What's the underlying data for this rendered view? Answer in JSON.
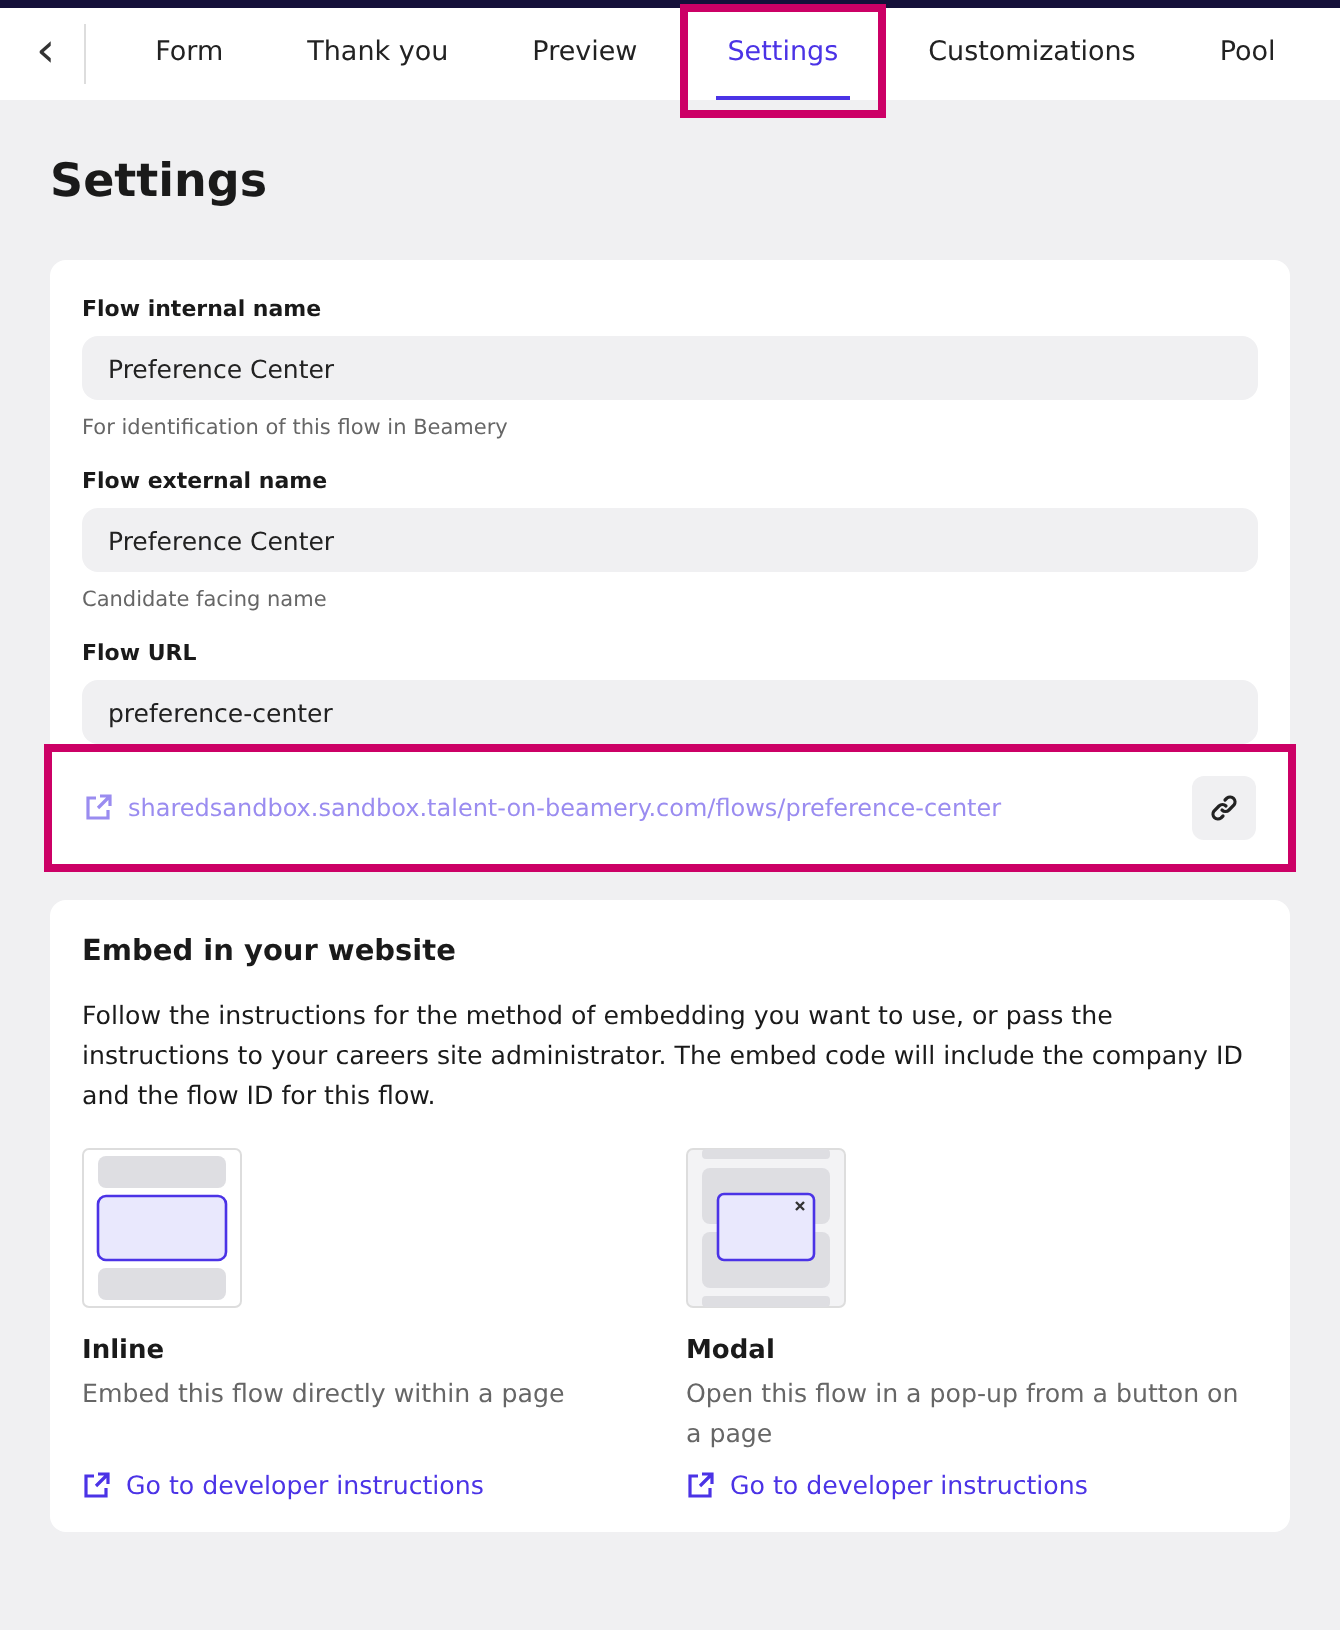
{
  "nav": {
    "back": "‹",
    "tabs": [
      {
        "label": "Form",
        "selected": false,
        "highlighted": false
      },
      {
        "label": "Thank you",
        "selected": false,
        "highlighted": false
      },
      {
        "label": "Preview",
        "selected": false,
        "highlighted": false
      },
      {
        "label": "Settings",
        "selected": true,
        "highlighted": true
      },
      {
        "label": "Customizations",
        "selected": false,
        "highlighted": false
      },
      {
        "label": "Pool",
        "selected": false,
        "highlighted": false
      }
    ]
  },
  "title": "Settings",
  "settings_card": {
    "fields": [
      {
        "label": "Flow internal name",
        "value": "Preference Center",
        "hint": "For identification of this flow in Beamery"
      },
      {
        "label": "Flow external name",
        "value": "Preference Center",
        "hint": "Candidate facing name"
      },
      {
        "label": "Flow URL",
        "value": "preference-center"
      }
    ],
    "url_link": {
      "text": "sharedsandbox.sandbox.talent-on-beamery.com/flows/preference-center",
      "highlighted": true
    }
  },
  "embed_card": {
    "title": "Embed in your website",
    "description": "Follow the instructions for the method of embedding you want to use, or pass the instructions to your careers site administrator. The embed code will include the company ID and the flow ID for this flow.",
    "options": [
      {
        "kind": "inline",
        "title": "Inline",
        "description": "Embed this flow directly within a page",
        "link": "Go to developer instructions"
      },
      {
        "kind": "modal",
        "title": "Modal",
        "description": "Open this flow in a pop-up from a button on a page",
        "link": "Go to developer instructions"
      }
    ]
  }
}
